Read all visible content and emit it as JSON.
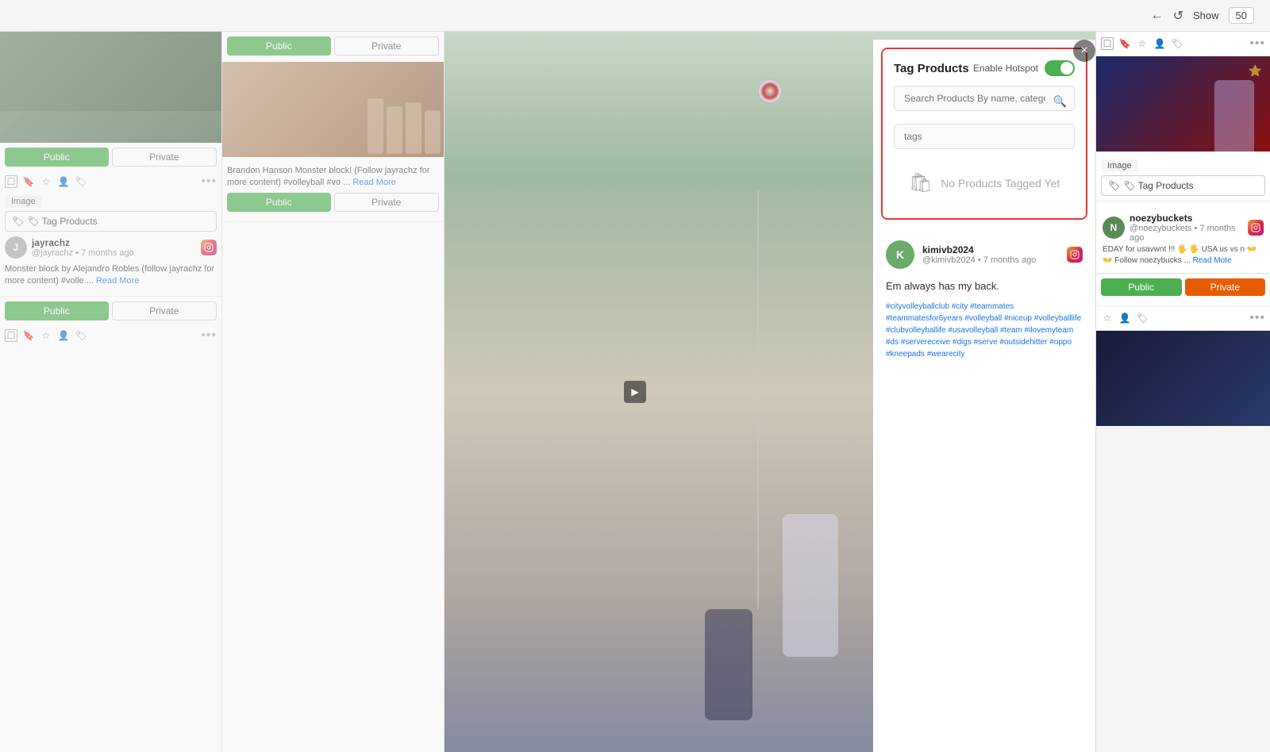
{
  "topbar": {
    "show_label": "Show",
    "count": "50",
    "refresh_icon": "↺",
    "back_icon": "←"
  },
  "col1": {
    "public_btn": "Public",
    "private_btn": "Private",
    "image_label": "Image",
    "tag_products_btn": "🏷 Tag Products",
    "user": {
      "name": "jayrachz",
      "handle": "@jayrachz • 7 months ago"
    },
    "post_text": "Monster block by Alejandro Robles (follow jayrachz for more content) #volle ...",
    "read_more": "Read More"
  },
  "col2": {
    "public_btn": "Public",
    "private_btn": "Private"
  },
  "modal": {
    "title": "Tag Products",
    "close_icon": "×",
    "enable_hotspot_label": "Enable Hotspot",
    "search_placeholder": "Search Products By name, category, SKU, tags",
    "tags_placeholder": "tags",
    "no_products_text": "No Products Tagged Yet",
    "bag_icon": "🛍"
  },
  "info_side": {
    "user": {
      "initial": "K",
      "name": "kimivb2024",
      "handle": "@kimivb2024 • 7 months ago"
    },
    "post_text": "Em always has my back.",
    "hashtags": "#cityvolleyballclub #city #teammates #teammatesfor6years #volleyball #niceup #volleyballlife #clubvolleyballife #usavolleyball #team #ilovemyteam #ds #servereceive #digs #serve #outsidehitter #oppo #kneepads #wearecity"
  },
  "right_col": {
    "top_public_btn": "Public",
    "top_private_btn": "Private",
    "tag_products_btn": "🏷 Tag Products",
    "user": {
      "name": "noezybuckets",
      "handle": "@noezybuckets • 7 months ago"
    },
    "post_text": "EDAY for usavwnt !!! 🖐 🖐 USA us vs n 👐 👐 Follow noezybucks ...",
    "read_more": "Read Mote",
    "public2_btn": "Public",
    "private2_btn": "Private",
    "icons": [
      "checkbox",
      "bookmark",
      "star",
      "person",
      "tag"
    ]
  },
  "icons": {
    "checkbox": "☐",
    "bookmark": "🔖",
    "star": "☆",
    "person": "👤",
    "tag": "🏷",
    "dots": "•••",
    "search": "🔍"
  }
}
